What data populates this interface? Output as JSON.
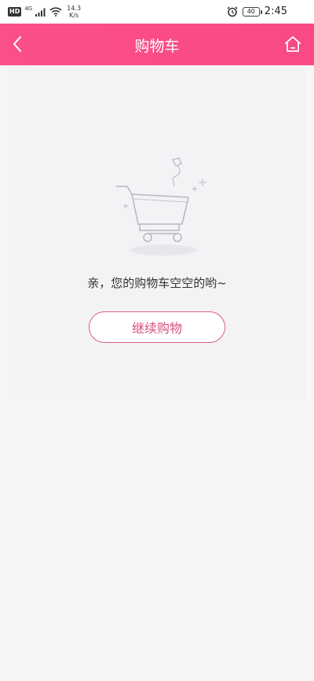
{
  "status_bar": {
    "hd_badge": "HD",
    "network_type": "4G",
    "net_speed_value": "14.3",
    "net_speed_unit": "K/s",
    "battery_level": "40",
    "time": "2:45"
  },
  "header": {
    "title": "购物车",
    "background_color": "#f84a84"
  },
  "empty_state": {
    "message": "亲，您的购物车空空的哟~",
    "continue_button_label": "继续购物",
    "accent_color": "#d9507a"
  },
  "icons": {
    "back": "chevron-left-icon",
    "home": "home-icon",
    "illustration": "empty-cart-illustration"
  }
}
